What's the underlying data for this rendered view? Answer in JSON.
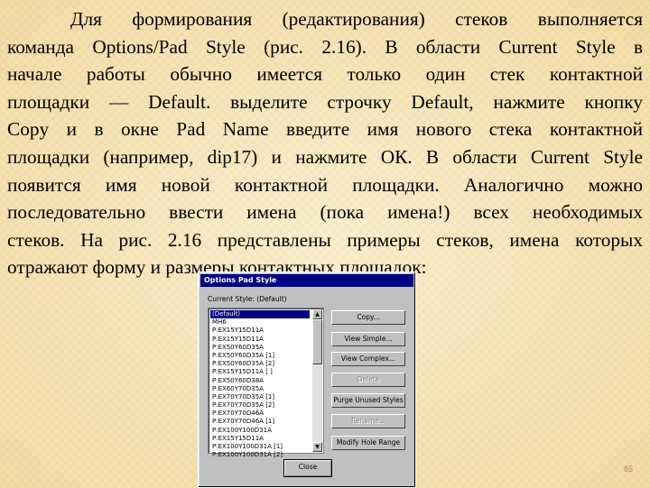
{
  "paragraph_lines": [
    "Для формирования (редактирования) стеков выполняется",
    "команда Options/Pad Style (рис. 2.16). В области Current Style в",
    "начале работы обычно имеется только один стек контактной",
    "площадки — Default. выделите строчку Default, нажмите кнопку",
    "Copy и в окне Pad Name введите имя нового стека контактной",
    "площадки (например, dip17) и нажмите ОК. В области Current Style",
    "появится имя новой контактной площадки. Аналогично можно",
    "последовательно ввести имена (пока имена!) всех необходимых",
    "стеков. На рис. 2.16 представлены примеры стеков, имена которых",
    "отражают форму и размеры контактных площадок:"
  ],
  "dialog": {
    "title": "Options Pad Style",
    "current_style_label": "Current Style: (Default)",
    "list_items": [
      "(Default)",
      "MH6",
      "P:EX15Y15D11A",
      "P:EX15Y15D11A",
      "P:EX50Y60D35A",
      "P:EX50Y60D35A [1]",
      "P:EX50Y60D35A [2]",
      "P:EX15Y15D11A [ ]",
      "P:EX50Y60D38A",
      "P:EX60Y70D35A",
      "P:EX70Y70D35A [1]",
      "P:EX70Y70D35A [2]",
      "P:EX70Y70D46A",
      "P:EX70Y70D46A [1]",
      "P:EX100Y100D31A",
      "P:EX15Y15D11A",
      "P:EX100Y100D31A [1]",
      "P:EX100Y100D31A [2]"
    ],
    "buttons": {
      "copy": "Copy...",
      "view_simple": "View Simple...",
      "view_complex": "View Complex...",
      "delete": "Delete",
      "purge": "Purge Unused Styles",
      "rename": "Rename...",
      "modify_hole": "Modify Hole Range"
    },
    "close": "Close"
  },
  "page_number": "85",
  "colors": {
    "title_bar": "#000080",
    "dialog_face": "#c0c0c0",
    "selected_item": "#000080",
    "page_number": "#b8863b"
  }
}
